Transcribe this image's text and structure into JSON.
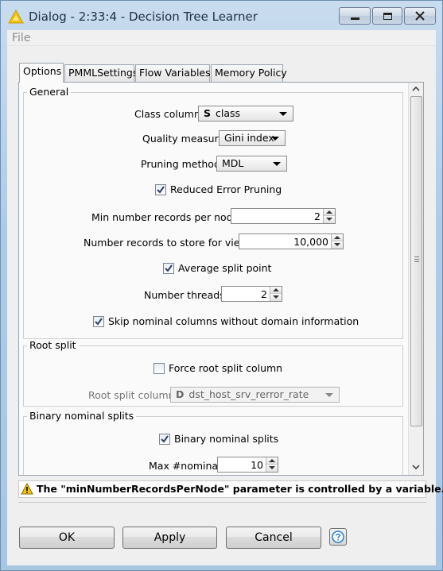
{
  "window": {
    "title": "Dialog - 2:33:4 - Decision Tree Learner",
    "controls": [
      "minimize-icon",
      "maximize-icon",
      "close-icon"
    ]
  },
  "menu": {
    "file": "File"
  },
  "tabs": [
    {
      "label": "Options",
      "active": true
    },
    {
      "label": "PMMLSettings",
      "active": false
    },
    {
      "label": "Flow Variables",
      "active": false
    },
    {
      "label": "Memory Policy",
      "active": false
    }
  ],
  "general": {
    "title": "General",
    "class_column_label": "Class column",
    "class_column_type": "S",
    "class_column_value": "class",
    "quality_label": "Quality measure",
    "quality_value": "Gini index",
    "pruning_label": "Pruning method",
    "pruning_value": "MDL",
    "reduced_error_label": "Reduced Error Pruning",
    "reduced_error_checked": true,
    "min_records_label": "Min number records per node",
    "min_records_value": "2",
    "num_records_view_label": "Number records to store for view",
    "num_records_view_value": "10,000",
    "avg_split_label": "Average split point",
    "avg_split_checked": true,
    "threads_label": "Number threads",
    "threads_value": "2",
    "skip_nominal_label": "Skip nominal columns without domain information",
    "skip_nominal_checked": true
  },
  "root_split": {
    "title": "Root split",
    "force_label": "Force root split column",
    "force_checked": false,
    "column_label": "Root split column",
    "column_type": "D",
    "column_value": "dst_host_srv_rerror_rate"
  },
  "binary": {
    "title": "Binary nominal splits",
    "checkbox_label": "Binary nominal splits",
    "checkbox_checked": true,
    "max_nominal_label": "Max #nominal",
    "max_nominal_value": "10"
  },
  "warning": {
    "text": "The \"minNumberRecordsPerNode\" parameter is controlled by a variable.",
    "icon": "warning-icon"
  },
  "buttons": {
    "ok": "OK",
    "apply": "Apply",
    "cancel": "Cancel",
    "help_icon": "help-icon"
  },
  "colors": {
    "title_bar": "#aecbe6",
    "warning_icon": "#f2c40d",
    "help_icon": "#2a7bd1"
  }
}
